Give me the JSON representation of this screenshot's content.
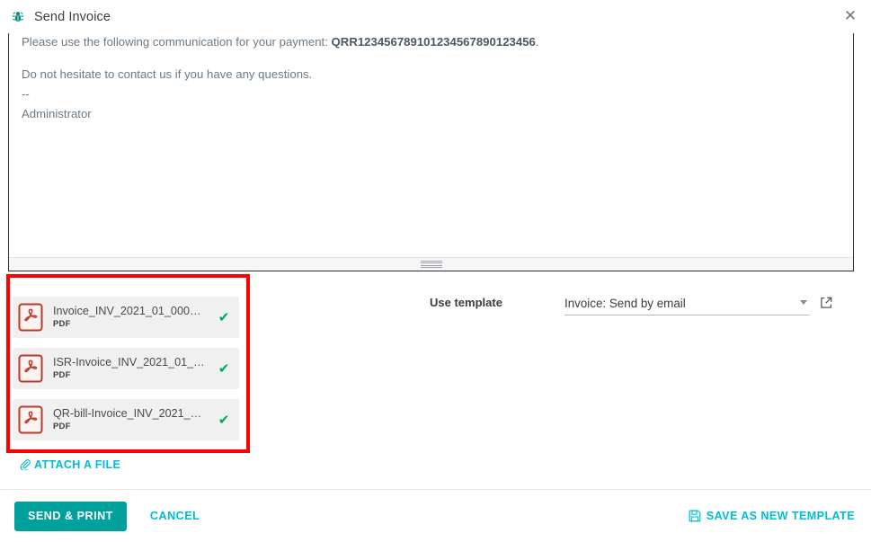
{
  "window": {
    "title": "Send Invoice",
    "title_icon": "bug-icon",
    "close_icon": "✕"
  },
  "editor": {
    "lines": [
      {
        "prefix": "Please use the following communication for your payment: ",
        "bold": "QRR123456789101234567890123456",
        "suffix": "."
      },
      {
        "prefix": "Do not hesitate to contact us if you have any questions.",
        "bold": "",
        "suffix": ""
      },
      {
        "prefix": "--",
        "bold": "",
        "suffix": ""
      },
      {
        "prefix": "Administrator",
        "bold": "",
        "suffix": ""
      }
    ],
    "line1_prefix": "Please use the following communication for your payment: ",
    "line1_bold": "QRR123456789101234567890123456",
    "line1_suffix": ".",
    "line2": "Do not hesitate to contact us if you have any questions.",
    "line3": "--",
    "line4": "Administrator",
    "resize_handle": "resize-grip"
  },
  "attachments": {
    "highlight_color": "#fe0000",
    "check_color": "#00a65a",
    "items": [
      {
        "name": "Invoice_INV_2021_01_000…",
        "type": "PDF",
        "status": "✔"
      },
      {
        "name": "ISR-Invoice_INV_2021_01_…",
        "type": "PDF",
        "status": "✔"
      },
      {
        "name": "QR-bill-Invoice_INV_2021_…",
        "type": "PDF",
        "status": "✔"
      }
    ],
    "attach_link_label": "ATTACH A FILE",
    "attach_link_icon": "paperclip-icon"
  },
  "template": {
    "label": "Use template",
    "selected": "Invoice: Send by email",
    "options": [
      "Invoice: Send by email"
    ],
    "external_link_icon": "external-link-icon"
  },
  "footer": {
    "send_print_label": "SEND & PRINT",
    "cancel_label": "CANCEL",
    "save_template_label": "SAVE AS NEW TEMPLATE",
    "save_icon": "floppy-disk-icon",
    "primary_color": "#00a09d",
    "link_color": "#00bcd4"
  }
}
